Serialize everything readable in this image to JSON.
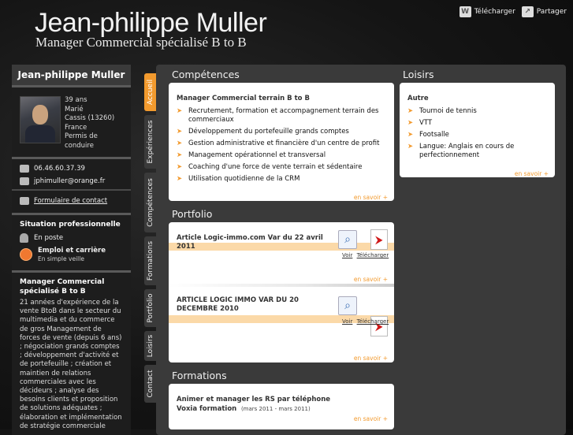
{
  "header": {
    "name": "Jean-philippe Muller",
    "subtitle": "Manager Commercial spécialisé B to B",
    "download_label": "Télécharger",
    "share_label": "Partager"
  },
  "sidebar": {
    "title": "Jean-philippe Muller",
    "info": {
      "age": "39 ans",
      "status": "Marié",
      "city": "Cassis (13260)",
      "country": "France",
      "license": "Permis de conduire"
    },
    "phone": "06.46.60.37.39",
    "email": "jphimuller@orange.fr",
    "contact_form": "Formulaire de contact",
    "situation_heading": "Situation professionnelle",
    "situation_value": "En poste",
    "career_heading": "Emploi et carrière",
    "career_value": "En simple veille",
    "summary_heading": "Manager Commercial spécialisé B to B",
    "summary_text": "21 années d'expérience de la vente BtoB dans le secteur du multimedia et du commerce de gros Management de forces de vente (depuis 6 ans) ; négociation grands comptes ; développement d'activité et de portefeuille ; création et maintien de relations commerciales avec les décideurs ; analyse des besoins clients et proposition de solutions adéquates ; élaboration et implémentation de stratégie commerciale"
  },
  "tabs": [
    "Accueil",
    "Expériences",
    "Compétences",
    "Formations",
    "Portfolio",
    "Loisirs",
    "Contact"
  ],
  "competences": {
    "title": "Compétences",
    "heading": "Manager Commercial terrain B to B",
    "items": [
      "Recrutement, formation et accompagnement terrain des commerciaux",
      "Développement du portefeuille grands comptes",
      "Gestion administrative et financière d'un centre de profit",
      "Management opérationnel et transversal",
      "Coaching d'une force de vente terrain et sédentaire",
      "Utilisation quotidienne de la CRM"
    ],
    "more": "en savoir +"
  },
  "loisirs": {
    "title": "Loisirs",
    "heading": "Autre",
    "items": [
      "Tournoi de tennis",
      "VTT",
      "Footsalle",
      "Langue: Anglais en cours de perfectionnement"
    ],
    "more": "en savoir +"
  },
  "portfolio": {
    "title": "Portfolio",
    "items": [
      {
        "title": "Article Logic-immo.com Var du 22 avril 2011",
        "view": "Voir",
        "download": "Télécharger",
        "more": "en savoir +"
      },
      {
        "title": "ARTICLE LOGIC IMMO VAR DU 20 DECEMBRE 2010",
        "view": "Voir",
        "download": "Télécharger",
        "more": "en savoir +"
      }
    ]
  },
  "formations": {
    "title": "Formations",
    "course": "Animer et manager les RS par téléphone",
    "school": "Voxia formation",
    "dates": "(mars 2011 - mars 2011)",
    "more": "en savoir +"
  }
}
